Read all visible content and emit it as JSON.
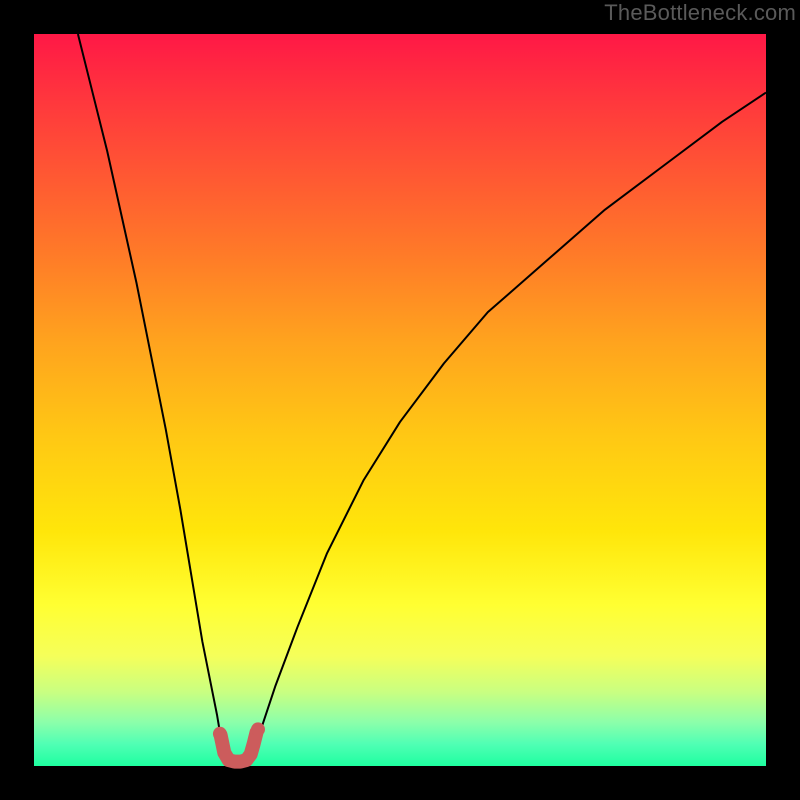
{
  "watermark": "TheBottleneck.com",
  "chart_data": {
    "type": "line",
    "title": "",
    "xlabel": "",
    "ylabel": "",
    "xlim": [
      0,
      100
    ],
    "ylim": [
      0,
      100
    ],
    "grid": false,
    "legend": false,
    "series": [
      {
        "name": "left-branch",
        "color": "#000000",
        "width": 2,
        "x": [
          6,
          8,
          10,
          12,
          14,
          16,
          18,
          20,
          21,
          22,
          23,
          24,
          25,
          25.5,
          26
        ],
        "y": [
          100,
          92,
          84,
          75,
          66,
          56,
          46,
          35,
          29,
          23,
          17,
          12,
          7,
          4,
          2
        ]
      },
      {
        "name": "right-branch",
        "color": "#000000",
        "width": 2,
        "x": [
          30,
          31,
          33,
          36,
          40,
          45,
          50,
          56,
          62,
          70,
          78,
          86,
          94,
          100
        ],
        "y": [
          2,
          5,
          11,
          19,
          29,
          39,
          47,
          55,
          62,
          69,
          76,
          82,
          88,
          92
        ]
      },
      {
        "name": "optimal-region",
        "color": "#cc5c5c",
        "width": 14,
        "cap": "round",
        "x": [
          25.5,
          26,
          26.6,
          27.4,
          28.2,
          29,
          29.6,
          30,
          30.4
        ],
        "y": [
          4.2,
          1.8,
          0.8,
          0.6,
          0.6,
          0.8,
          1.6,
          3.0,
          4.6
        ]
      }
    ],
    "points": [
      {
        "name": "optimal-cap-left",
        "x": 25.4,
        "y": 4.4,
        "r": 7,
        "color": "#cc5c5c"
      },
      {
        "name": "optimal-cap-right",
        "x": 30.6,
        "y": 5.0,
        "r": 7,
        "color": "#cc5c5c"
      }
    ]
  }
}
